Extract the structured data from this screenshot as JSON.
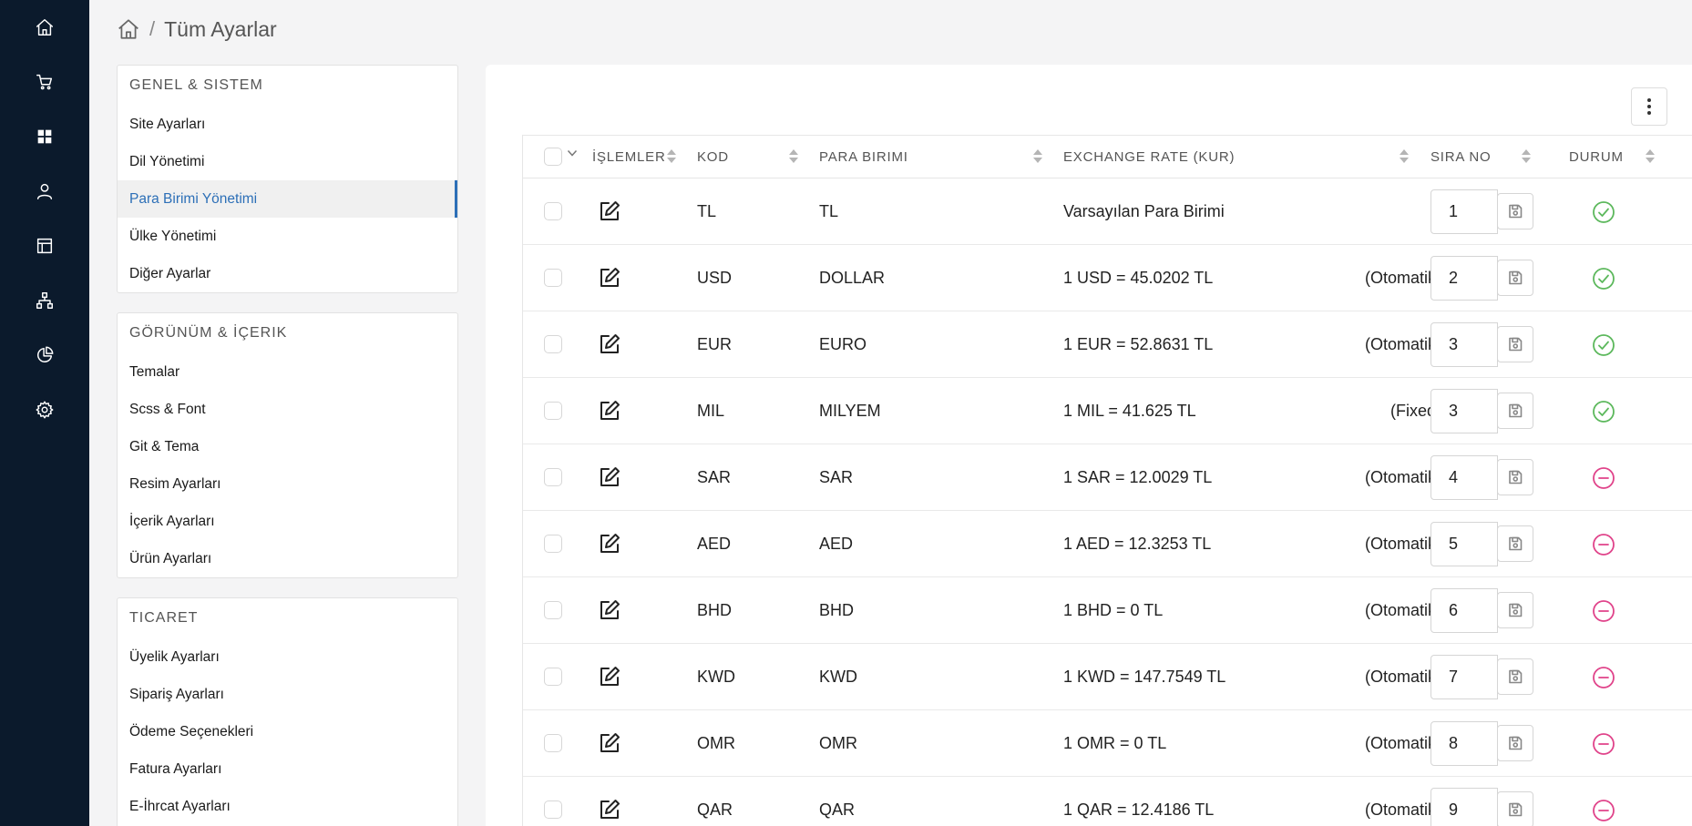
{
  "colors": {
    "rail_bg": "#0b1a2c",
    "active_link": "#2c6fb7",
    "status_active": "#5cb85c",
    "status_passive": "#e0438a"
  },
  "rail": {
    "icons": [
      "home-icon",
      "cart-icon",
      "dashboard-icon",
      "user-icon",
      "layout-icon",
      "sitemap-icon",
      "pie-chart-icon",
      "gear-icon"
    ]
  },
  "breadcrumb": {
    "separator": "/",
    "title": "Tüm Ayarlar"
  },
  "panels": [
    {
      "title": "GENEL & SISTEM",
      "items": [
        "Site Ayarları",
        "Dil Yönetimi",
        "Para Birimi Yönetimi",
        "Ülke Yönetimi",
        "Diğer Ayarlar"
      ],
      "active": "Para Birimi Yönetimi"
    },
    {
      "title": "GÖRÜNÜM & İÇERIK",
      "items": [
        "Temalar",
        "Scss & Font",
        "Git & Tema",
        "Resim Ayarları",
        "İçerik Ayarları",
        "Ürün Ayarları"
      ]
    },
    {
      "title": "TICARET",
      "items": [
        "Üyelik Ayarları",
        "Sipariş Ayarları",
        "Ödeme Seçenekleri",
        "Fatura Ayarları",
        "E-İhrcat Ayarları"
      ]
    }
  ],
  "table": {
    "headers": {
      "actions": "İŞLEMLER",
      "code": "KOD",
      "currency": "PARA BIRIMI",
      "rate": "EXCHANGE RATE (KUR)",
      "order": "SIRA NO",
      "status": "DURUM"
    },
    "rows": [
      {
        "code": "TL",
        "currency": "TL",
        "rate": "Varsayılan Para Birimi",
        "mode": "",
        "order": "1",
        "status": "active"
      },
      {
        "code": "USD",
        "currency": "DOLLAR",
        "rate": "1 USD = 45.0202 TL",
        "mode": "(Otomatik)",
        "order": "2",
        "status": "active"
      },
      {
        "code": "EUR",
        "currency": "EURO",
        "rate": "1 EUR = 52.8631 TL",
        "mode": "(Otomatik)",
        "order": "3",
        "status": "active"
      },
      {
        "code": "MIL",
        "currency": "MILYEM",
        "rate": "1 MIL = 41.625 TL",
        "mode": "(Fixed)",
        "order": "3",
        "status": "active"
      },
      {
        "code": "SAR",
        "currency": "SAR",
        "rate": "1 SAR = 12.0029 TL",
        "mode": "(Otomatik)",
        "order": "4",
        "status": "passive"
      },
      {
        "code": "AED",
        "currency": "AED",
        "rate": "1 AED = 12.3253 TL",
        "mode": "(Otomatik)",
        "order": "5",
        "status": "passive"
      },
      {
        "code": "BHD",
        "currency": "BHD",
        "rate": "1 BHD = 0 TL",
        "mode": "(Otomatik)",
        "order": "6",
        "status": "passive"
      },
      {
        "code": "KWD",
        "currency": "KWD",
        "rate": "1 KWD = 147.7549 TL",
        "mode": "(Otomatik)",
        "order": "7",
        "status": "passive"
      },
      {
        "code": "OMR",
        "currency": "OMR",
        "rate": "1 OMR = 0 TL",
        "mode": "(Otomatik)",
        "order": "8",
        "status": "passive"
      },
      {
        "code": "QAR",
        "currency": "QAR",
        "rate": "1 QAR = 12.4186 TL",
        "mode": "(Otomatik)",
        "order": "9",
        "status": "passive"
      }
    ]
  }
}
